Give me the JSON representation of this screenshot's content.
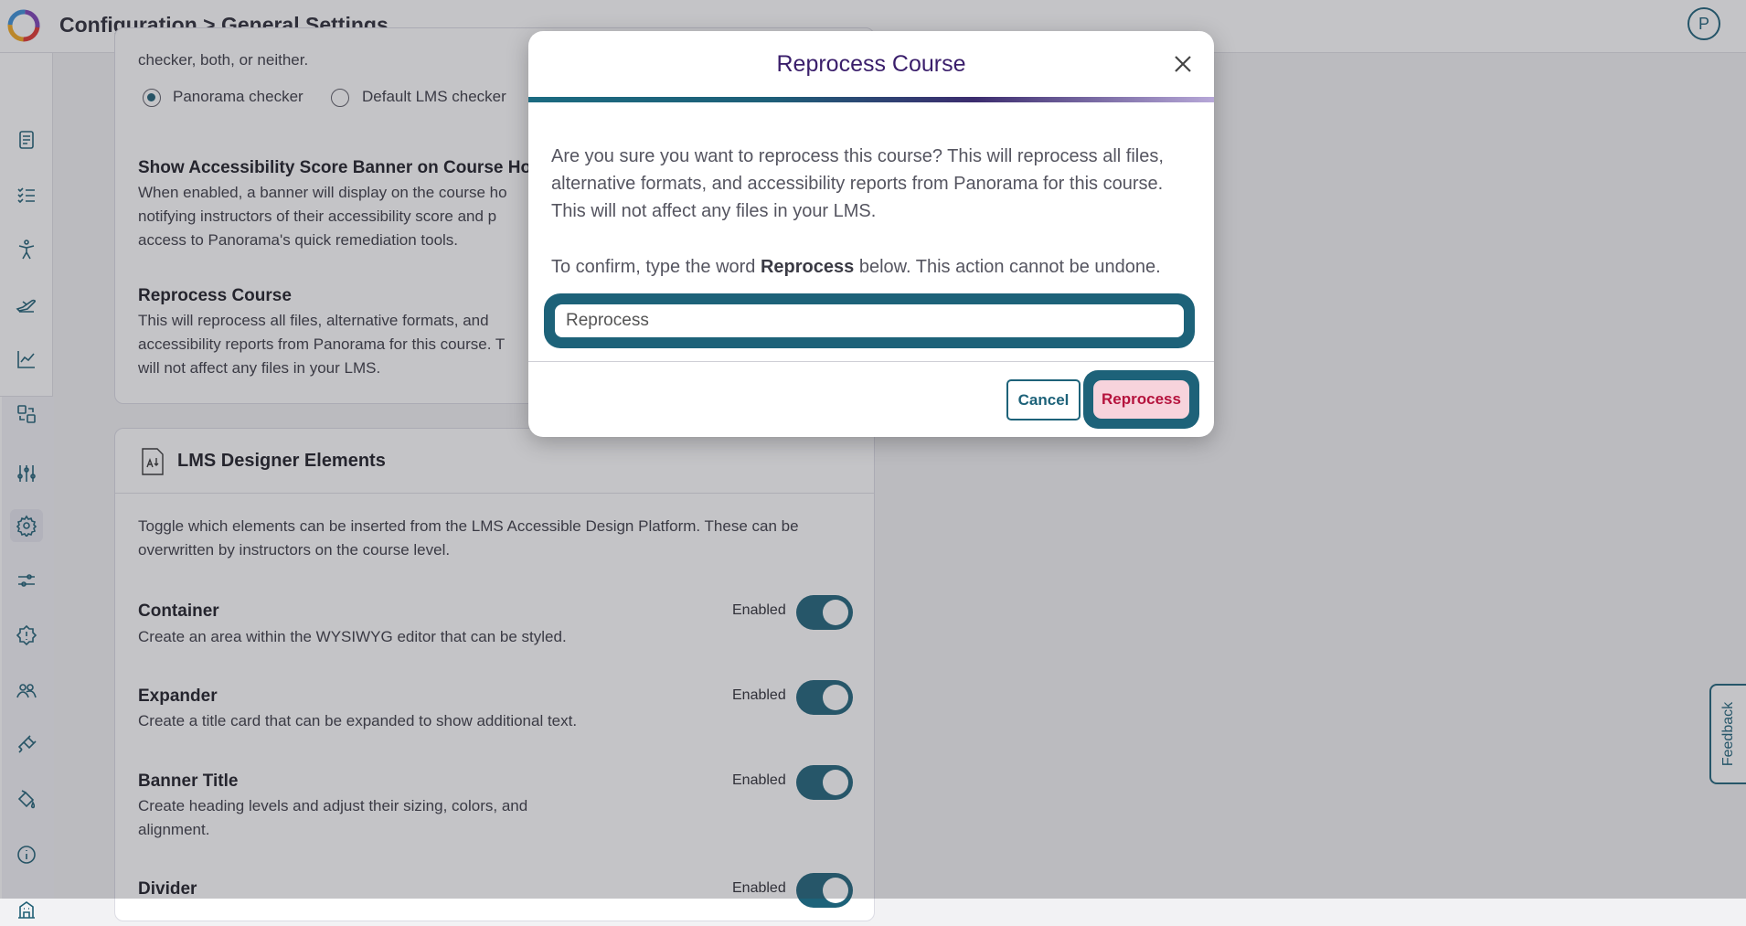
{
  "header": {
    "title": "Configuration > General Settings",
    "avatar_initial": "P"
  },
  "sidebar": {
    "items": [
      {
        "icon": "document-icon"
      },
      {
        "icon": "checklist-icon"
      },
      {
        "icon": "accessibility-person-icon"
      },
      {
        "icon": "plane-icon"
      },
      {
        "icon": "line-chart-icon"
      },
      {
        "icon": "transfer-icon"
      },
      {
        "icon": "sliders-icon"
      },
      {
        "icon": "gear-icon",
        "active": true
      },
      {
        "icon": "filter-sliders-icon"
      },
      {
        "icon": "alert-badge-icon"
      },
      {
        "icon": "users-icon"
      },
      {
        "icon": "plug-icon"
      },
      {
        "icon": "paint-bucket-icon"
      },
      {
        "icon": "info-icon"
      },
      {
        "icon": "building-icon"
      }
    ]
  },
  "background": {
    "checker_desc_tail": "checker, both, or neither.",
    "radio_panorama": "Panorama checker",
    "radio_default": "Default LMS checker",
    "banner_title": "Show Accessibility Score Banner on Course Hom",
    "banner_desc_1": "When enabled, a banner will display on the course ho",
    "banner_desc_2": "notifying instructors of their accessibility score and p",
    "banner_desc_3": "access to Panorama's quick remediation tools.",
    "reprocess_title": "Reprocess Course",
    "reprocess_desc_1": "This will reprocess all files, alternative formats, and",
    "reprocess_desc_2": "accessibility reports from Panorama for this course. T",
    "reprocess_desc_3": "will not affect any files in your LMS.",
    "designer_title": "LMS Designer Elements",
    "designer_desc_1": "Toggle which elements can be inserted from the LMS Accessible Design Platform. These can be",
    "designer_desc_2": "overwritten by instructors on the course level.",
    "elements": [
      {
        "name": "Container",
        "desc": "Create an area within the WYSIWYG editor that can be styled.",
        "status": "Enabled"
      },
      {
        "name": "Expander",
        "desc": "Create a title card that can be expanded to show additional text.",
        "status": "Enabled"
      },
      {
        "name": "Banner Title",
        "desc": "Create heading levels and adjust their sizing, colors, and",
        "desc2": "alignment.",
        "status": "Enabled"
      },
      {
        "name": "Divider",
        "desc": "",
        "status": "Enabled"
      }
    ]
  },
  "feedback_label": "Feedback",
  "modal": {
    "title": "Reprocess Course",
    "para1_line1": "Are you sure you want to reprocess this course? This will reprocess all files,",
    "para1_line2": "alternative formats, and accessibility reports from Panorama for this course.",
    "para1_line3": "This will not affect any files in your LMS.",
    "confirm_before": "To confirm, type the word ",
    "confirm_word": "Reprocess",
    "confirm_after": " below. This action cannot be undone.",
    "input_value": "Reprocess",
    "cancel_label": "Cancel",
    "reprocess_label": "Reprocess"
  },
  "colors": {
    "accent": "#1d6279",
    "title_purple": "#3a1e6b",
    "danger_text": "#b5133d",
    "danger_bg": "#f7d3dc"
  }
}
